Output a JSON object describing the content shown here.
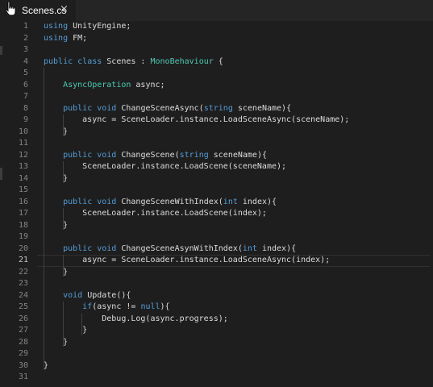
{
  "tab": {
    "title": "Scenes.cs",
    "close_glyph": "×"
  },
  "editor": {
    "active_line": 21,
    "lines": [
      {
        "n": "1",
        "tokens": [
          {
            "t": "using",
            "c": "kw"
          },
          {
            "t": " UnityEngine;",
            "c": "pl"
          }
        ]
      },
      {
        "n": "2",
        "tokens": [
          {
            "t": "using",
            "c": "kw"
          },
          {
            "t": " FM;",
            "c": "pl"
          }
        ]
      },
      {
        "n": "3",
        "tokens": []
      },
      {
        "n": "4",
        "tokens": [
          {
            "t": "public",
            "c": "kw"
          },
          {
            "t": " ",
            "c": "pl"
          },
          {
            "t": "class",
            "c": "kw"
          },
          {
            "t": " Scenes : ",
            "c": "pl"
          },
          {
            "t": "MonoBehaviour",
            "c": "ty"
          },
          {
            "t": " {",
            "c": "pl"
          }
        ]
      },
      {
        "n": "5",
        "tokens": []
      },
      {
        "n": "6",
        "tokens": [
          {
            "t": "    ",
            "c": "pl"
          },
          {
            "t": "AsyncOperation",
            "c": "ty"
          },
          {
            "t": " async;",
            "c": "pl"
          }
        ]
      },
      {
        "n": "7",
        "tokens": []
      },
      {
        "n": "8",
        "tokens": [
          {
            "t": "    ",
            "c": "pl"
          },
          {
            "t": "public",
            "c": "kw"
          },
          {
            "t": " ",
            "c": "pl"
          },
          {
            "t": "void",
            "c": "kw"
          },
          {
            "t": " ChangeSceneAsync(",
            "c": "pl"
          },
          {
            "t": "string",
            "c": "kw"
          },
          {
            "t": " sceneName){",
            "c": "pl"
          }
        ]
      },
      {
        "n": "9",
        "tokens": [
          {
            "t": "        async = SceneLoader.instance.LoadSceneAsync(sceneName);",
            "c": "pl"
          }
        ]
      },
      {
        "n": "10",
        "tokens": [
          {
            "t": "    }",
            "c": "pl"
          }
        ]
      },
      {
        "n": "11",
        "tokens": []
      },
      {
        "n": "12",
        "tokens": [
          {
            "t": "    ",
            "c": "pl"
          },
          {
            "t": "public",
            "c": "kw"
          },
          {
            "t": " ",
            "c": "pl"
          },
          {
            "t": "void",
            "c": "kw"
          },
          {
            "t": " ChangeScene(",
            "c": "pl"
          },
          {
            "t": "string",
            "c": "kw"
          },
          {
            "t": " sceneName){",
            "c": "pl"
          }
        ]
      },
      {
        "n": "13",
        "tokens": [
          {
            "t": "        SceneLoader.instance.LoadScene(sceneName);",
            "c": "pl"
          }
        ]
      },
      {
        "n": "14",
        "tokens": [
          {
            "t": "    }",
            "c": "pl"
          }
        ]
      },
      {
        "n": "15",
        "tokens": []
      },
      {
        "n": "16",
        "tokens": [
          {
            "t": "    ",
            "c": "pl"
          },
          {
            "t": "public",
            "c": "kw"
          },
          {
            "t": " ",
            "c": "pl"
          },
          {
            "t": "void",
            "c": "kw"
          },
          {
            "t": " ChangeSceneWithIndex(",
            "c": "pl"
          },
          {
            "t": "int",
            "c": "kw"
          },
          {
            "t": " index){",
            "c": "pl"
          }
        ]
      },
      {
        "n": "17",
        "tokens": [
          {
            "t": "        SceneLoader.instance.LoadScene(index);",
            "c": "pl"
          }
        ]
      },
      {
        "n": "18",
        "tokens": [
          {
            "t": "    }",
            "c": "pl"
          }
        ]
      },
      {
        "n": "19",
        "tokens": []
      },
      {
        "n": "20",
        "tokens": [
          {
            "t": "    ",
            "c": "pl"
          },
          {
            "t": "public",
            "c": "kw"
          },
          {
            "t": " ",
            "c": "pl"
          },
          {
            "t": "void",
            "c": "kw"
          },
          {
            "t": " ChangeSceneAsynWithIndex(",
            "c": "pl"
          },
          {
            "t": "int",
            "c": "kw"
          },
          {
            "t": " index){",
            "c": "pl"
          }
        ]
      },
      {
        "n": "21",
        "tokens": [
          {
            "t": "        async = SceneLoader.instance.LoadSceneAsync(index);",
            "c": "pl"
          }
        ]
      },
      {
        "n": "22",
        "tokens": [
          {
            "t": "    }",
            "c": "pl"
          }
        ]
      },
      {
        "n": "23",
        "tokens": []
      },
      {
        "n": "24",
        "tokens": [
          {
            "t": "    ",
            "c": "pl"
          },
          {
            "t": "void",
            "c": "kw"
          },
          {
            "t": " Update(){",
            "c": "pl"
          }
        ]
      },
      {
        "n": "25",
        "tokens": [
          {
            "t": "        ",
            "c": "pl"
          },
          {
            "t": "if",
            "c": "kw"
          },
          {
            "t": "(async != ",
            "c": "pl"
          },
          {
            "t": "null",
            "c": "kw"
          },
          {
            "t": "){",
            "c": "pl"
          }
        ]
      },
      {
        "n": "26",
        "tokens": [
          {
            "t": "            Debug.Log(async.progress);",
            "c": "pl"
          }
        ]
      },
      {
        "n": "27",
        "tokens": [
          {
            "t": "        }",
            "c": "pl"
          }
        ]
      },
      {
        "n": "28",
        "tokens": [
          {
            "t": "    }",
            "c": "pl"
          }
        ]
      },
      {
        "n": "29",
        "tokens": []
      },
      {
        "n": "30",
        "tokens": [
          {
            "t": "}",
            "c": "pl"
          }
        ]
      },
      {
        "n": "31",
        "tokens": []
      }
    ]
  }
}
